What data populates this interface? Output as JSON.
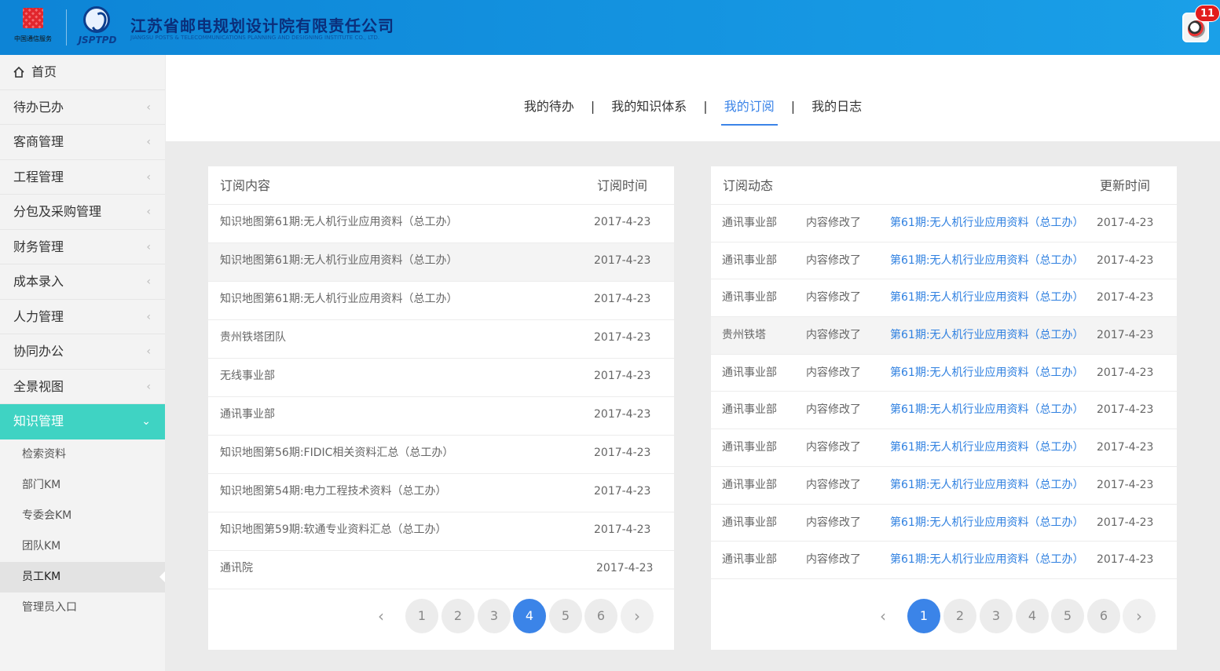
{
  "header": {
    "logo_left_caption": "中国通信服务",
    "logo_right_caption": "JSPTPD",
    "company_name": "江苏省邮电规划设计院有限责任公司",
    "company_en": "JIANGSU POSTS & TELECOMMUNICATIONS PLANNING AND DESIGNING INSTITUTE CO., LTD.",
    "notification_count": "11"
  },
  "sidebar": {
    "items": [
      {
        "label": "首页",
        "icon": "home-icon"
      },
      {
        "label": "待办已办",
        "icon": "chevron-left-icon"
      },
      {
        "label": "客商管理",
        "icon": "chevron-left-icon"
      },
      {
        "label": "工程管理",
        "icon": "chevron-left-icon"
      },
      {
        "label": "分包及采购管理",
        "icon": "chevron-left-icon"
      },
      {
        "label": "财务管理",
        "icon": "chevron-left-icon"
      },
      {
        "label": "成本录入",
        "icon": "chevron-left-icon"
      },
      {
        "label": "人力管理",
        "icon": "chevron-left-icon"
      },
      {
        "label": "协同办公",
        "icon": "chevron-left-icon"
      },
      {
        "label": "全景视图",
        "icon": "chevron-left-icon"
      },
      {
        "label": "知识管理",
        "icon": "chevron-down-icon"
      }
    ],
    "sub_items": [
      "检索资料",
      "部门KM",
      "专委会KM",
      "团队KM",
      "员工KM",
      "管理员入口"
    ]
  },
  "tabs": [
    "我的待办",
    "我的知识体系",
    "我的订阅",
    "我的日志"
  ],
  "left_panel": {
    "headers": [
      "订阅内容",
      "订阅时间"
    ],
    "rows": [
      [
        "知识地图第61期:无人机行业应用资料（总工办）",
        "2017-4-23"
      ],
      [
        "知识地图第61期:无人机行业应用资料（总工办）",
        "2017-4-23"
      ],
      [
        "知识地图第61期:无人机行业应用资料（总工办）",
        "2017-4-23"
      ],
      [
        "贵州铁塔团队",
        "2017-4-23"
      ],
      [
        "无线事业部",
        "2017-4-23"
      ],
      [
        "通讯事业部",
        "2017-4-23"
      ],
      [
        "知识地图第56期:FIDIC相关资料汇总（总工办）",
        "2017-4-23"
      ],
      [
        "知识地图第54期:电力工程技术资料（总工办）",
        "2017-4-23"
      ],
      [
        "知识地图第59期:软通专业资料汇总（总工办）",
        "2017-4-23"
      ],
      [
        "通讯院",
        "2017-4-23"
      ]
    ],
    "pages": [
      "1",
      "2",
      "3",
      "4",
      "5",
      "6"
    ],
    "current_page": "4",
    "prev": "‹",
    "next": "›"
  },
  "right_panel": {
    "headers": [
      "订阅动态",
      "更新时间"
    ],
    "rows": [
      [
        "通讯事业部",
        "内容修改了",
        "第61期:无人机行业应用资料（总工办）",
        "2017-4-23"
      ],
      [
        "通讯事业部",
        "内容修改了",
        "第61期:无人机行业应用资料（总工办）",
        "2017-4-23"
      ],
      [
        "通讯事业部",
        "内容修改了",
        "第61期:无人机行业应用资料（总工办）",
        "2017-4-23"
      ],
      [
        "贵州铁塔",
        "内容修改了",
        "第61期:无人机行业应用资料（总工办）",
        "2017-4-23"
      ],
      [
        "通讯事业部",
        "内容修改了",
        "第61期:无人机行业应用资料（总工办）",
        "2017-4-23"
      ],
      [
        "通讯事业部",
        "内容修改了",
        "第61期:无人机行业应用资料（总工办）",
        "2017-4-23"
      ],
      [
        "通讯事业部",
        "内容修改了",
        "第61期:无人机行业应用资料（总工办）",
        "2017-4-23"
      ],
      [
        "通讯事业部",
        "内容修改了",
        "第61期:无人机行业应用资料（总工办）",
        "2017-4-23"
      ],
      [
        "通讯事业部",
        "内容修改了",
        "第61期:无人机行业应用资料（总工办）",
        "2017-4-23"
      ],
      [
        "通讯事业部",
        "内容修改了",
        "第61期:无人机行业应用资料（总工办）",
        "2017-4-23"
      ]
    ],
    "pages": [
      "1",
      "2",
      "3",
      "4",
      "5",
      "6"
    ],
    "current_page": "1",
    "prev": "‹",
    "next": "›"
  },
  "colors": {
    "header_blue": "#1aa0e8",
    "accent_teal": "#3fd3c3",
    "link_blue": "#2f80e0",
    "page_current": "#3b84e8",
    "badge_red": "#e21d1d"
  }
}
